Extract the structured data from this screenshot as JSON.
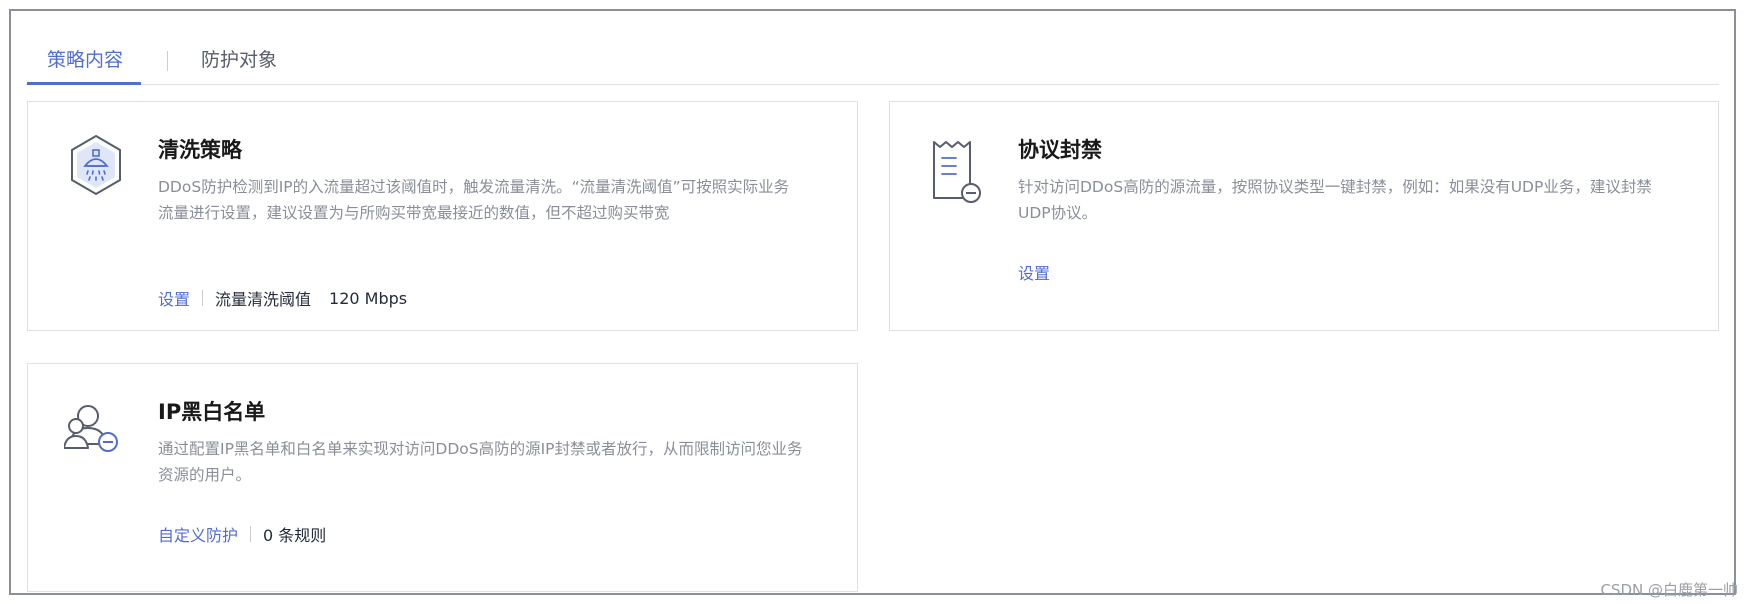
{
  "tabs": {
    "active": "策略内容",
    "inactive": "防护对象"
  },
  "cards": {
    "cleaning": {
      "title": "清洗策略",
      "desc": "DDoS防护检测到IP的入流量超过该阈值时，触发流量清洗。“流量清洗阈值”可按照实际业务流量进行设置，建议设置为与所购买带宽最接近的数值，但不超过购买带宽",
      "link": "设置",
      "label": "流量清洗阈值",
      "value": "120 Mbps",
      "icon": "shield-shower-icon"
    },
    "protocol": {
      "title": "协议封禁",
      "desc": "针对访问DDoS高防的源流量，按照协议类型一键封禁，例如：如果没有UDP业务，建议封禁UDP协议。",
      "link": "设置",
      "icon": "document-minus-icon"
    },
    "ip_list": {
      "title": "IP黑白名单",
      "desc": "通过配置IP黑名单和白名单来实现对访问DDoS高防的源IP封禁或者放行，从而限制访问您业务资源的用户。",
      "link": "自定义防护",
      "value": "0 条规则",
      "icon": "users-minus-icon"
    }
  },
  "watermark": "CSDN @白鹿第一帅",
  "colors": {
    "accent": "#526ecc",
    "border": "#dfe1e6",
    "muted_text": "#8a8e99"
  }
}
